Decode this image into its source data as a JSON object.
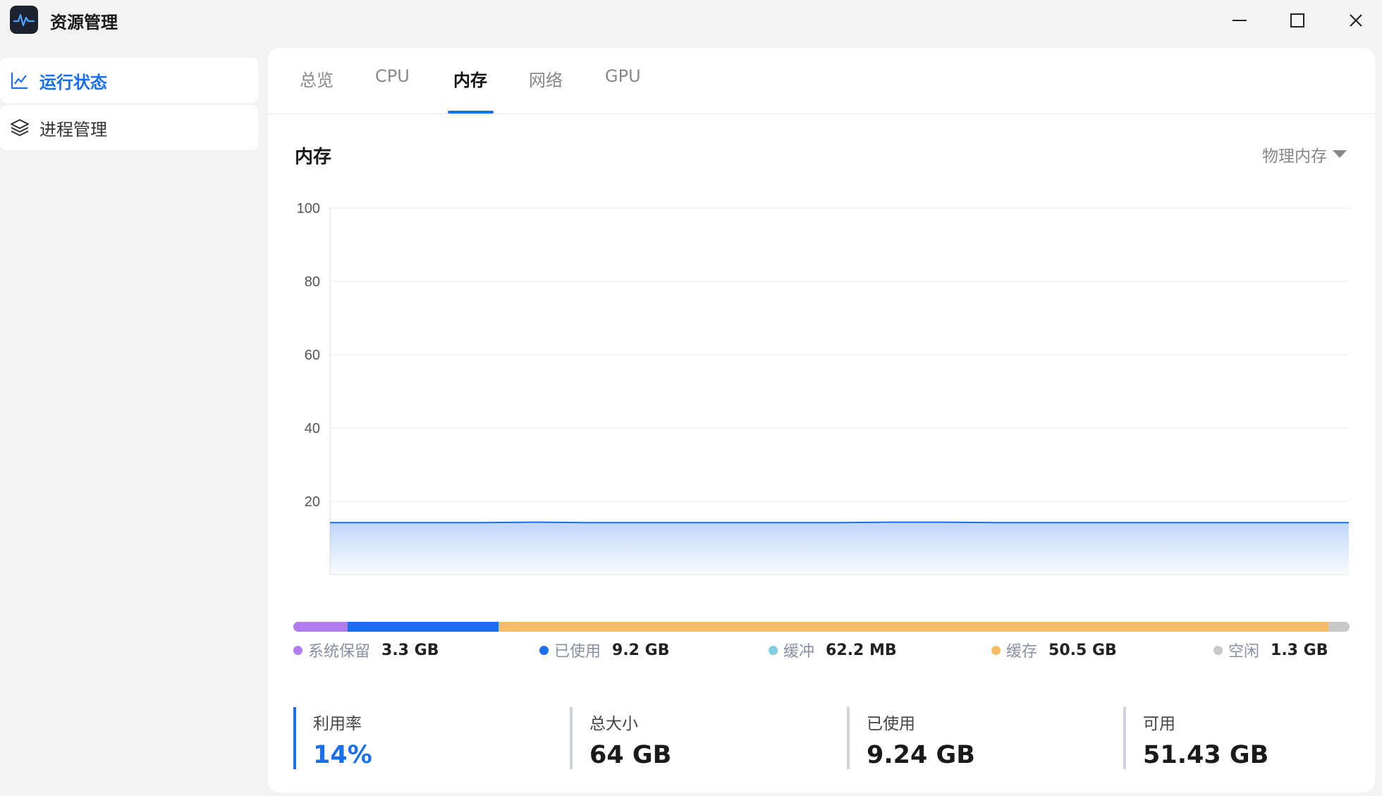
{
  "app": {
    "title": "资源管理"
  },
  "sidebar": {
    "items": [
      {
        "label": "运行状态",
        "icon": "line-chart-icon",
        "active": true
      },
      {
        "label": "进程管理",
        "icon": "layers-icon",
        "active": false
      }
    ]
  },
  "tabs": [
    {
      "label": "总览"
    },
    {
      "label": "CPU"
    },
    {
      "label": "内存",
      "active": true
    },
    {
      "label": "网络"
    },
    {
      "label": "GPU"
    }
  ],
  "section": {
    "title": "内存",
    "dropdown": "物理内存"
  },
  "chart_data": {
    "type": "area",
    "ylim": [
      0,
      100
    ],
    "yticks": [
      20,
      40,
      60,
      80,
      100
    ],
    "series": [
      {
        "values": [
          14.2,
          14.2,
          14.2,
          14.2,
          14.3,
          14.2,
          14.2,
          14.2,
          14.2,
          14.2,
          14.2,
          14.3,
          14.3,
          14.2,
          14.2,
          14.2,
          14.2,
          14.2,
          14.2,
          14.2,
          14.2
        ]
      }
    ],
    "grid": true,
    "color": "#1a6ef0"
  },
  "memory_breakdown": [
    {
      "name": "系统保留",
      "value": "3.3 GB",
      "gb": 3.3,
      "color": "#b07cf0"
    },
    {
      "name": "已使用",
      "value": "9.2 GB",
      "gb": 9.2,
      "color": "#1a6ef0"
    },
    {
      "name": "缓冲",
      "value": "62.2 MB",
      "gb": 0.06,
      "color": "#7ecde0"
    },
    {
      "name": "缓存",
      "value": "50.5 GB",
      "gb": 50.5,
      "color": "#f5bd63"
    },
    {
      "name": "空闲",
      "value": "1.3 GB",
      "gb": 1.3,
      "color": "#c8c8c8"
    }
  ],
  "stats": [
    {
      "label": "利用率",
      "value": "14%"
    },
    {
      "label": "总大小",
      "value": "64 GB"
    },
    {
      "label": "已使用",
      "value": "9.24 GB"
    },
    {
      "label": "可用",
      "value": "51.43 GB"
    }
  ]
}
